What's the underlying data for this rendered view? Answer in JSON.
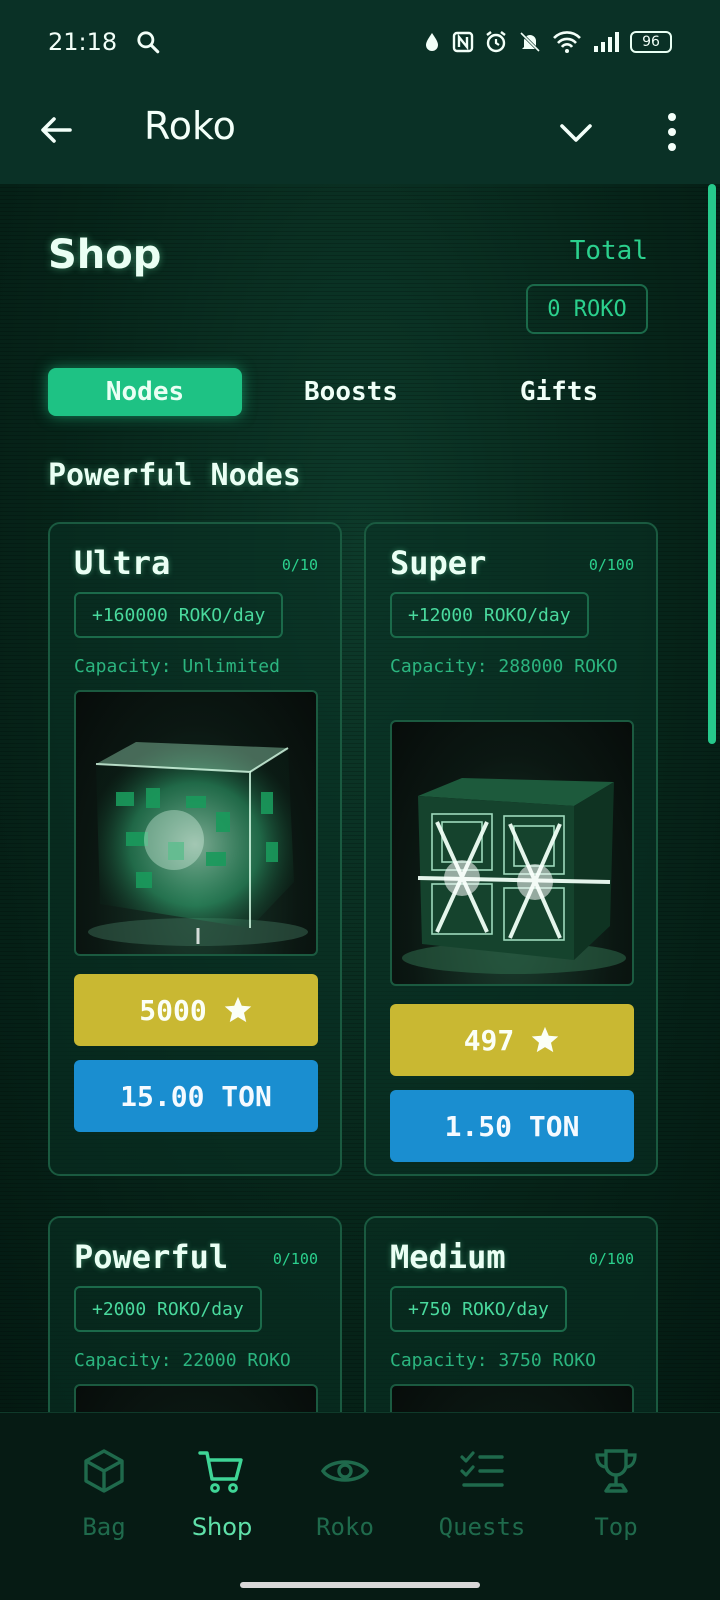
{
  "status_bar": {
    "time": "21:18",
    "battery": "96",
    "icons": [
      "search-icon",
      "data-saver-icon",
      "nfc-icon",
      "alarm-icon",
      "mute-icon",
      "wifi-icon",
      "signal-icon",
      "battery-icon"
    ]
  },
  "app_bar": {
    "title": "Roko",
    "icons": [
      "back-arrow-icon",
      "chevron-down-icon",
      "more-vert-icon"
    ]
  },
  "shop": {
    "title": "Shop",
    "total_label": "Total",
    "total_value": "0 ROKO",
    "tabs": [
      {
        "label": "Nodes",
        "active": true
      },
      {
        "label": "Boosts",
        "active": false
      },
      {
        "label": "Gifts",
        "active": false
      }
    ],
    "section_title": "Powerful Nodes",
    "cards": [
      {
        "name": "Ultra",
        "count": "0/10",
        "rate": "+160000 ROKO/day",
        "capacity": "Capacity: Unlimited",
        "stars_price": "5000",
        "ton_price": "15.00 TON"
      },
      {
        "name": "Super",
        "count": "0/100",
        "rate": "+12000 ROKO/day",
        "capacity": "Capacity: 288000 ROKO",
        "stars_price": "497",
        "ton_price": "1.50 TON"
      },
      {
        "name": "Powerful",
        "count": "0/100",
        "rate": "+2000 ROKO/day",
        "capacity": "Capacity: 22000 ROKO"
      },
      {
        "name": "Medium",
        "count": "0/100",
        "rate": "+750 ROKO/day",
        "capacity": "Capacity: 3750 ROKO"
      }
    ]
  },
  "bottom_nav": [
    {
      "label": "Bag",
      "icon": "cube-icon",
      "active": false
    },
    {
      "label": "Shop",
      "icon": "cart-icon",
      "active": true
    },
    {
      "label": "Roko",
      "icon": "eye-icon",
      "active": false
    },
    {
      "label": "Quests",
      "icon": "checklist-icon",
      "active": false
    },
    {
      "label": "Top",
      "icon": "trophy-icon",
      "active": false
    }
  ],
  "colors": {
    "accent_green": "#1ec284",
    "stars_button": "#c9b832",
    "ton_button": "#1a8ed0",
    "background": "#041e16"
  }
}
